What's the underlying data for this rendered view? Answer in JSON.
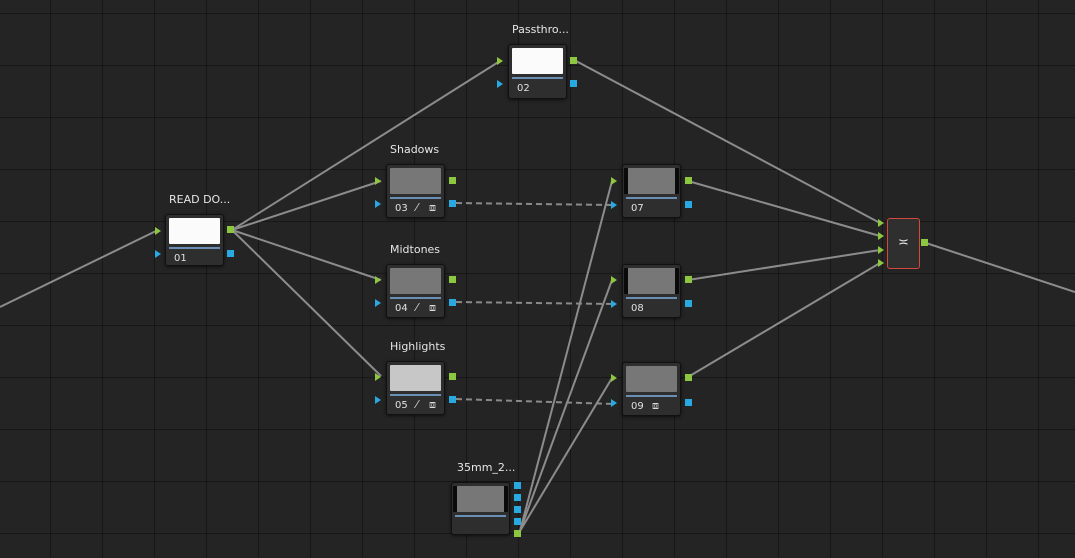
{
  "nodes": {
    "n01": {
      "title": "READ DO...",
      "number": "01"
    },
    "n02": {
      "title": "Passthro...",
      "number": "02"
    },
    "n03": {
      "title": "Shadows",
      "number": "03"
    },
    "n04": {
      "title": "Midtones",
      "number": "04"
    },
    "n05": {
      "title": "Highlights",
      "number": "05"
    },
    "n07": {
      "title": "",
      "number": "07"
    },
    "n08": {
      "title": "",
      "number": "08"
    },
    "n09": {
      "title": "",
      "number": "09"
    },
    "ext": {
      "title": "35mm_2...",
      "number": ""
    }
  },
  "icons": {
    "qualifier": "eyedropper-icon",
    "window": "window-icon",
    "mixer": "layer-mixer-icon"
  },
  "colors": {
    "rgb_port": "#8dc63f",
    "key_port": "#29a9e1",
    "mixer_border": "#d5483c",
    "node_separator": "#6a8fb5"
  }
}
